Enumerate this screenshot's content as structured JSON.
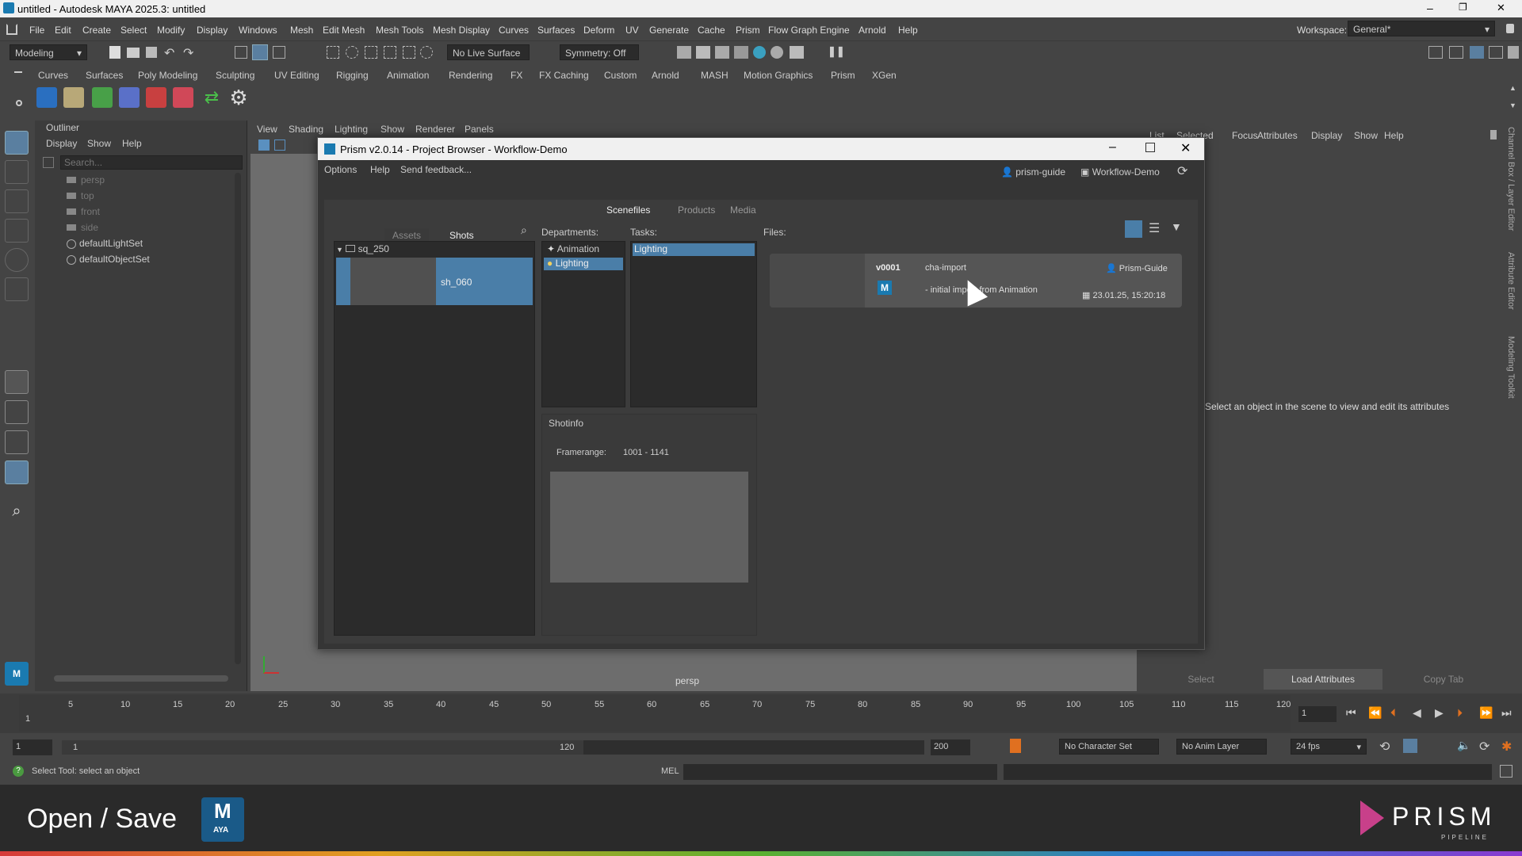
{
  "window": {
    "title": "untitled - Autodesk MAYA 2025.3: untitled",
    "controls": [
      "–",
      "❐",
      "✕"
    ]
  },
  "menubar": {
    "items": [
      "File",
      "Edit",
      "Create",
      "Select",
      "Modify",
      "Display",
      "Windows",
      "Mesh",
      "Edit Mesh",
      "Mesh Tools",
      "Mesh Display",
      "Curves",
      "Surfaces",
      "Deform",
      "UV",
      "Generate",
      "Cache",
      "Prism",
      "Flow Graph Engine",
      "Arnold",
      "Help"
    ],
    "workspace_label": "Workspace:",
    "workspace_value": "General*"
  },
  "toolbar": {
    "mode": "Modeling",
    "live_surface": "No Live Surface",
    "symmetry": "Symmetry: Off"
  },
  "shelf": {
    "tabs": [
      "Curves",
      "Surfaces",
      "Poly Modeling",
      "Sculpting",
      "UV Editing",
      "Rigging",
      "Animation",
      "Rendering",
      "FX",
      "FX Caching",
      "Custom",
      "Arnold",
      "MASH",
      "Motion Graphics",
      "Prism",
      "XGen"
    ]
  },
  "outliner": {
    "title": "Outliner",
    "menu": [
      "Display",
      "Show",
      "Help"
    ],
    "search_placeholder": "Search...",
    "items": [
      "persp",
      "top",
      "front",
      "side",
      "defaultLightSet",
      "defaultObjectSet"
    ]
  },
  "viewport": {
    "menu": [
      "View",
      "Shading",
      "Lighting",
      "Show",
      "Renderer",
      "Panels"
    ],
    "camera_label": "persp"
  },
  "attribute_editor": {
    "menu": [
      "List",
      "Selected",
      "Focus",
      "Attributes",
      "Display",
      "Show",
      "Help"
    ],
    "empty_message": "Select an object in the scene to view and edit its attributes",
    "buttons": [
      "Select",
      "Load Attributes",
      "Copy Tab"
    ],
    "side_tabs": [
      "Channel Box / Layer Editor",
      "Attribute Editor",
      "Modeling Toolkit"
    ]
  },
  "prism": {
    "title": "Prism v2.0.14 - Project Browser - Workflow-Demo",
    "menu": [
      "Options",
      "Help",
      "Send feedback..."
    ],
    "user": "prism-guide",
    "project": "Workflow-Demo",
    "tabs": [
      "Scenefiles",
      "Products",
      "Media"
    ],
    "entity_tabs": [
      "Assets",
      "Shots"
    ],
    "sequence": "sq_250",
    "shot": "sh_060",
    "departments_label": "Departments:",
    "departments": [
      "Animation",
      "Lighting"
    ],
    "tasks_label": "Tasks:",
    "tasks": [
      "Lighting"
    ],
    "files_label": "Files:",
    "file": {
      "version": "v0001",
      "name": "cha-import",
      "comment": "- initial import from Animation",
      "author": "Prism-Guide",
      "date": "23.01.25,  15:20:18"
    },
    "shotinfo_label": "Shotinfo",
    "framerange_label": "Framerange:",
    "framerange_value": "1001 - 1141"
  },
  "timeline": {
    "ticks": [
      "5",
      "10",
      "15",
      "20",
      "25",
      "30",
      "35",
      "40",
      "45",
      "50",
      "55",
      "60",
      "65",
      "70",
      "75",
      "80",
      "85",
      "90",
      "95",
      "100",
      "105",
      "110",
      "115",
      "120"
    ],
    "first_label": "1",
    "current_frame": "1"
  },
  "range": {
    "start": "1",
    "inner_start": "1",
    "inner_end": "120",
    "end": "200",
    "character_set": "No Character Set",
    "anim_layer": "No Anim Layer",
    "fps": "24 fps"
  },
  "status": {
    "help_text": "Select Tool: select an object",
    "mel_label": "MEL"
  },
  "banner": {
    "title": "Open / Save",
    "logo_text": "PRISM",
    "logo_sub": "PIPELINE",
    "app_badge": "AYA"
  },
  "colors": {
    "accent": "#4a7ea8",
    "maya_blue": "#1a7ab0"
  }
}
